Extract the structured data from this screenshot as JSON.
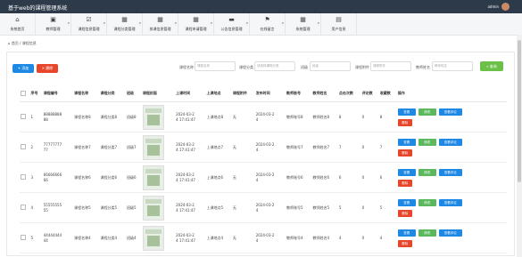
{
  "app": {
    "title": "基于web的课程管理系统",
    "user": "admin"
  },
  "nav": [
    {
      "label": "系统首页",
      "icon": "home-icon",
      "glyph": "⌂"
    },
    {
      "label": "教师管理",
      "icon": "briefcase-icon",
      "glyph": "▣"
    },
    {
      "label": "课程信息管理",
      "icon": "check-icon",
      "glyph": "☑"
    },
    {
      "label": "课程分类管理",
      "icon": "grid-icon",
      "glyph": "▦"
    },
    {
      "label": "排课信息管理",
      "icon": "grid-icon",
      "glyph": "▦"
    },
    {
      "label": "课程申请管理",
      "icon": "apps-icon",
      "glyph": "▦"
    },
    {
      "label": "公告信息管理",
      "icon": "message-icon",
      "glyph": "▬"
    },
    {
      "label": "在线留言",
      "icon": "flag-icon",
      "glyph": "⚑"
    },
    {
      "label": "系统管理",
      "icon": "apps-icon",
      "glyph": "▦"
    },
    {
      "label": "用户信息",
      "icon": "calendar-icon",
      "glyph": "▤"
    }
  ],
  "breadcrumb": {
    "home": "首页",
    "sep": "/",
    "current": "课程信息"
  },
  "toolbar": {
    "add": "添加",
    "delete": "删除",
    "search": "查询"
  },
  "filters": [
    {
      "label": "课程名称",
      "placeholder": "课程名称"
    },
    {
      "label": "课程分类",
      "placeholder": "请选择课程分类"
    },
    {
      "label": "班级",
      "placeholder": "班级"
    },
    {
      "label": "课程附件",
      "placeholder": "课程附件"
    },
    {
      "label": "教师姓名",
      "placeholder": "教师姓名"
    }
  ],
  "table": {
    "headers": [
      "序号",
      "课程编号",
      "课程名称",
      "课程分类",
      "班级",
      "课程封面",
      "上课时间",
      "上课地点",
      "课程附件",
      "发布时间",
      "教师账号",
      "教师姓名",
      "点击次数",
      "评论数",
      "收藏数",
      "操作"
    ],
    "row_buttons": {
      "view": "查看",
      "edit": "修改",
      "comments": "查看评论",
      "delete": "删除"
    },
    "rows": [
      {
        "no": "1",
        "code": "8888888888",
        "name": "课程名称8",
        "category": "课程分类8",
        "cls": "班级8",
        "time": "2024-03-24 17:41:47",
        "place": "上课地点8",
        "attach": "无",
        "pub": "2024-03-24",
        "tacc": "教师账号8",
        "tname": "教师姓名8",
        "clicks": "8",
        "comments": "0",
        "favs": "8"
      },
      {
        "no": "2",
        "code": "7777777777",
        "name": "课程名称7",
        "category": "课程分类7",
        "cls": "班级7",
        "time": "2024-03-24 17:41:47",
        "place": "上课地点7",
        "attach": "无",
        "pub": "2024-03-24",
        "tacc": "教师账号7",
        "tname": "教师姓名7",
        "clicks": "7",
        "comments": "0",
        "favs": "7"
      },
      {
        "no": "3",
        "code": "6666666666",
        "name": "课程名称6",
        "category": "课程分类6",
        "cls": "班级6",
        "time": "2024-03-24 17:41:47",
        "place": "上课地点6",
        "attach": "无",
        "pub": "2024-03-24",
        "tacc": "教师账号6",
        "tname": "教师姓名6",
        "clicks": "6",
        "comments": "0",
        "favs": "6"
      },
      {
        "no": "4",
        "code": "5555555555",
        "name": "课程名称5",
        "category": "课程分类5",
        "cls": "班级5",
        "time": "2024-03-24 17:41:47",
        "place": "上课地点5",
        "attach": "无",
        "pub": "2024-03-24",
        "tacc": "教师账号5",
        "tname": "教师姓名5",
        "clicks": "5",
        "comments": "0",
        "favs": "5"
      },
      {
        "no": "5",
        "code": "4444444444",
        "name": "课程名称4",
        "category": "课程分类4",
        "cls": "班级4",
        "time": "2024-03-24 17:41:47",
        "place": "上课地点4",
        "attach": "无",
        "pub": "2024-03-24",
        "tacc": "教师账号4",
        "tname": "教师姓名4",
        "clicks": "4",
        "comments": "0",
        "favs": "4"
      }
    ]
  },
  "colors": {
    "topbar": "#2d3a4a",
    "primary": "#1e88e5",
    "danger": "#e8462a",
    "success": "#5cb85c",
    "search": "#6cc04a"
  }
}
